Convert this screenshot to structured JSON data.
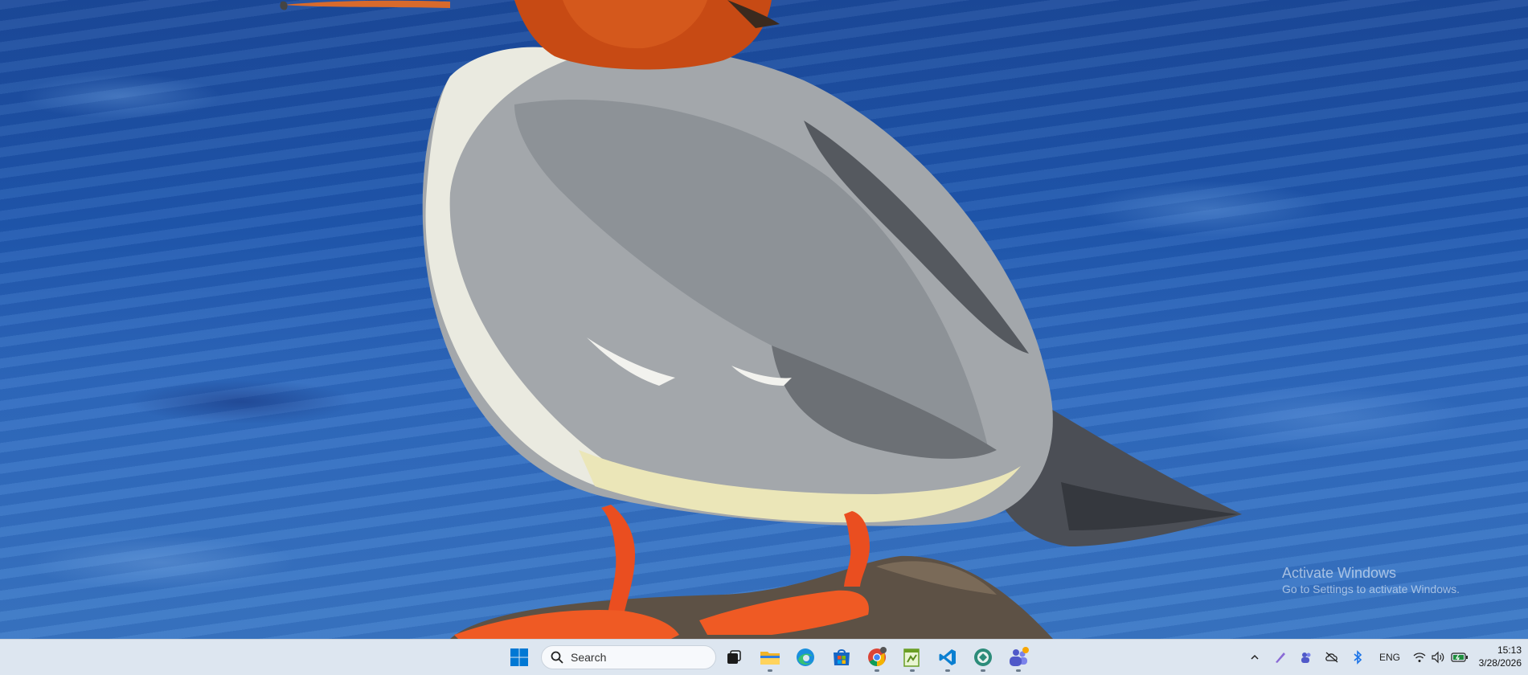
{
  "watermark": {
    "title": "Activate Windows",
    "subtitle": "Go to Settings to activate Windows."
  },
  "taskbar": {
    "search_label": "Search",
    "pinned": [
      {
        "name": "start-icon"
      },
      {
        "name": "task-view-icon"
      },
      {
        "name": "file-explorer-icon"
      },
      {
        "name": "edge-icon"
      },
      {
        "name": "microsoft-store-icon"
      },
      {
        "name": "chrome-icon"
      },
      {
        "name": "notepad-plus-icon"
      },
      {
        "name": "vscode-icon"
      },
      {
        "name": "app-circle-icon"
      },
      {
        "name": "teams-icon"
      }
    ],
    "tray": {
      "language": "ENG",
      "time": "15:13",
      "date": "3/28/2026"
    }
  },
  "colors": {
    "taskbar_bg": "#dde6f0",
    "windows_blue": "#0078d4"
  }
}
